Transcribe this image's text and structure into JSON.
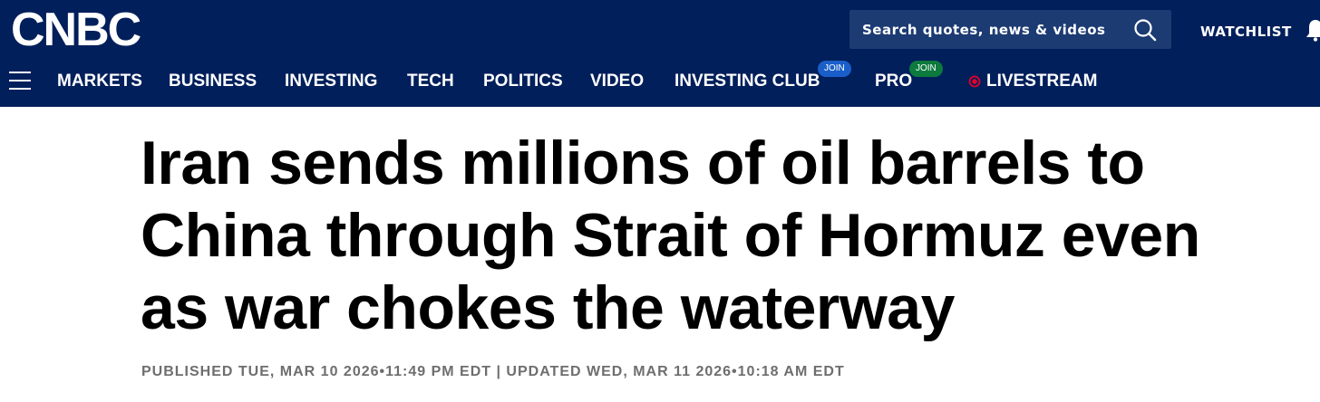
{
  "brand": {
    "logo_text": "CNBC",
    "colors": {
      "header_bg": "#001f5b",
      "search_bg": "#1c3b73",
      "join_blue": "#1a5fc9",
      "join_green": "#0d7a3e",
      "live_red": "#e4002b"
    }
  },
  "header": {
    "search_placeholder": "Search quotes, news & videos",
    "search_icon": "search-icon",
    "watchlist_label": "WATCHLIST",
    "bell_icon": "bell-icon",
    "menu_icon": "menu-icon"
  },
  "nav": {
    "items": [
      {
        "label": "MARKETS"
      },
      {
        "label": "BUSINESS"
      },
      {
        "label": "INVESTING"
      },
      {
        "label": "TECH"
      },
      {
        "label": "POLITICS"
      },
      {
        "label": "VIDEO"
      },
      {
        "label": "INVESTING CLUB",
        "badge": "JOIN"
      },
      {
        "label": "PRO",
        "badge": "JOIN"
      },
      {
        "label": "LIVESTREAM"
      }
    ]
  },
  "article": {
    "headline_lines": [
      "Iran sends millions of oil barrels to",
      "China through Strait of Hormuz even",
      "as war chokes the waterway"
    ],
    "timestamp": "PUBLISHED TUE, MAR 10 2026•11:49 PM EDT | UPDATED WED, MAR 11 2026•10:18 AM EDT"
  }
}
